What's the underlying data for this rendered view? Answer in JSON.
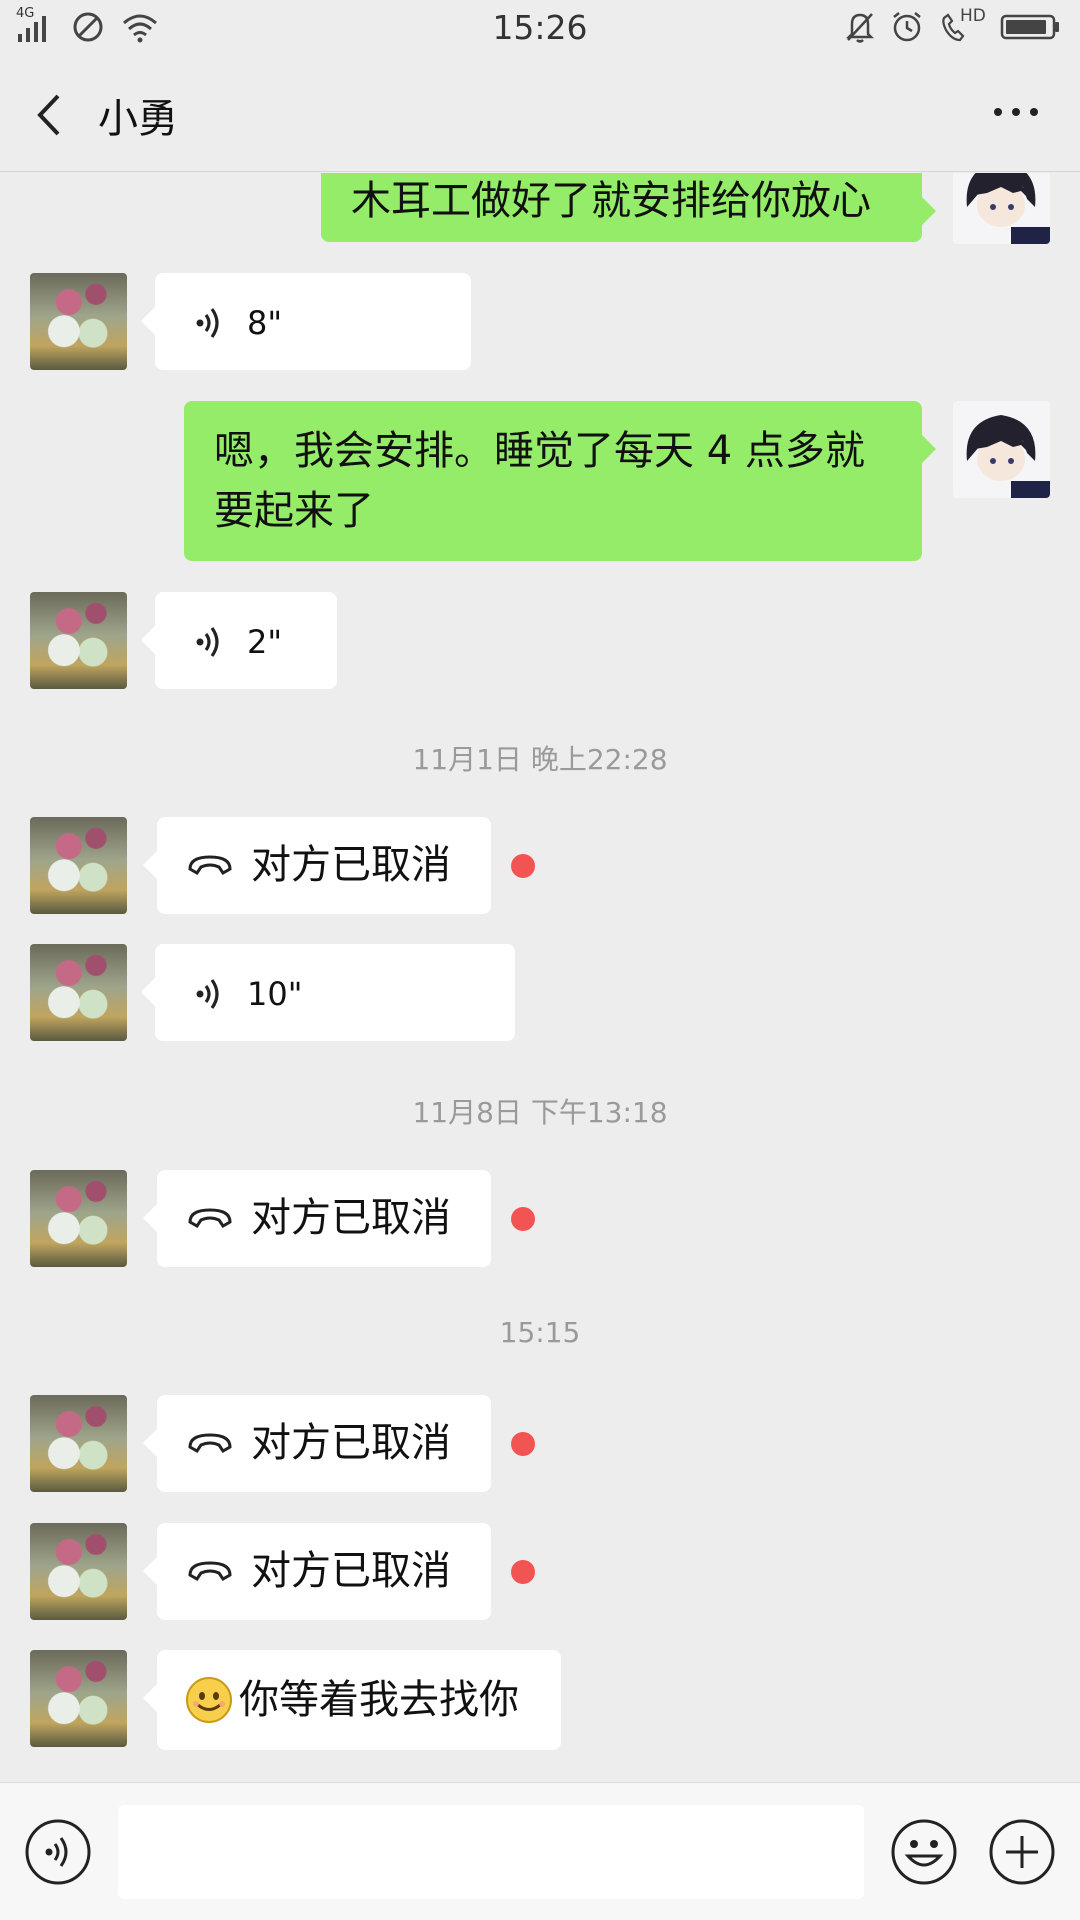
{
  "status_bar": {
    "network": "4G",
    "time": "15:26",
    "hd": "HD"
  },
  "header": {
    "title": "小勇"
  },
  "messages": {
    "m1": {
      "side": "me",
      "type": "text",
      "text": "木耳工做好了就安排给你放心"
    },
    "m2": {
      "side": "friend",
      "type": "voice",
      "duration": "8\""
    },
    "m3": {
      "side": "me",
      "type": "text",
      "line1": "嗯，我会安排。睡觉了每天 4 点多就",
      "line2": "要起来了"
    },
    "m4": {
      "side": "friend",
      "type": "voice",
      "duration": "2\""
    },
    "ts1": "11月1日 晚上22:28",
    "m5": {
      "side": "friend",
      "type": "call",
      "text": "对方已取消",
      "unread": true
    },
    "m6": {
      "side": "friend",
      "type": "voice",
      "duration": "10\""
    },
    "ts2": "11月8日 下午13:18",
    "m7": {
      "side": "friend",
      "type": "call",
      "text": "对方已取消",
      "unread": true
    },
    "ts3": "15:15",
    "m8": {
      "side": "friend",
      "type": "call",
      "text": "对方已取消",
      "unread": true
    },
    "m9": {
      "side": "friend",
      "type": "call",
      "text": "对方已取消",
      "unread": true
    },
    "m10": {
      "side": "friend",
      "type": "text",
      "emoji": "smile-emoji",
      "text": "你等着我去找你"
    }
  },
  "input_bar": {
    "value": ""
  },
  "colors": {
    "background": "#ededed",
    "my_bubble": "#95ec69",
    "friend_bubble": "#ffffff",
    "unread_dot": "#f25454"
  },
  "icons": [
    "signal-icon",
    "dnd-icon",
    "wifi-icon",
    "bell-muted-icon",
    "alarm-icon",
    "call-hd-icon",
    "battery-icon",
    "back-icon",
    "more-icon",
    "voice-icon",
    "call-cancel-icon",
    "emoji-icon",
    "plus-icon"
  ]
}
